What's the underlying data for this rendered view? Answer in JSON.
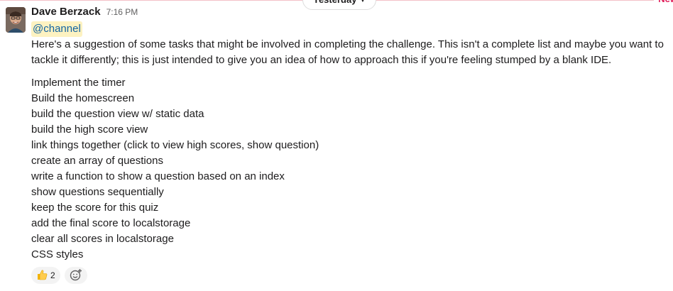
{
  "day_divider": {
    "label": "Yesterday",
    "new_label": "New"
  },
  "message": {
    "author": "Dave Berzack",
    "time": "7:16 PM",
    "mention": "@channel",
    "text": "Here's a suggestion of some tasks that might be involved in completing the challenge. This isn't a complete list and maybe you want to tackle it differently; this is just intended to give you an idea of how to approach this if you're feeling stumped by a blank IDE.",
    "tasks": [
      "Implement the timer",
      "Build the homescreen",
      "build the question view w/ static data",
      "build the high score view",
      "link things together (click to view high scores, show question)",
      "create an array of questions",
      "write a function to show a question based on an index",
      "show questions sequentially",
      "keep the score for this quiz",
      "add the final score to localstorage",
      "clear all scores in localstorage",
      "CSS styles"
    ]
  },
  "reactions": [
    {
      "emoji": "thumbs-up-icon",
      "count": "2"
    }
  ],
  "add_reaction_icon": "add-emoji-icon",
  "colors": {
    "new_accent": "#e01e5a",
    "mention_bg": "#fdf2c1",
    "mention_text": "#1264a3"
  }
}
